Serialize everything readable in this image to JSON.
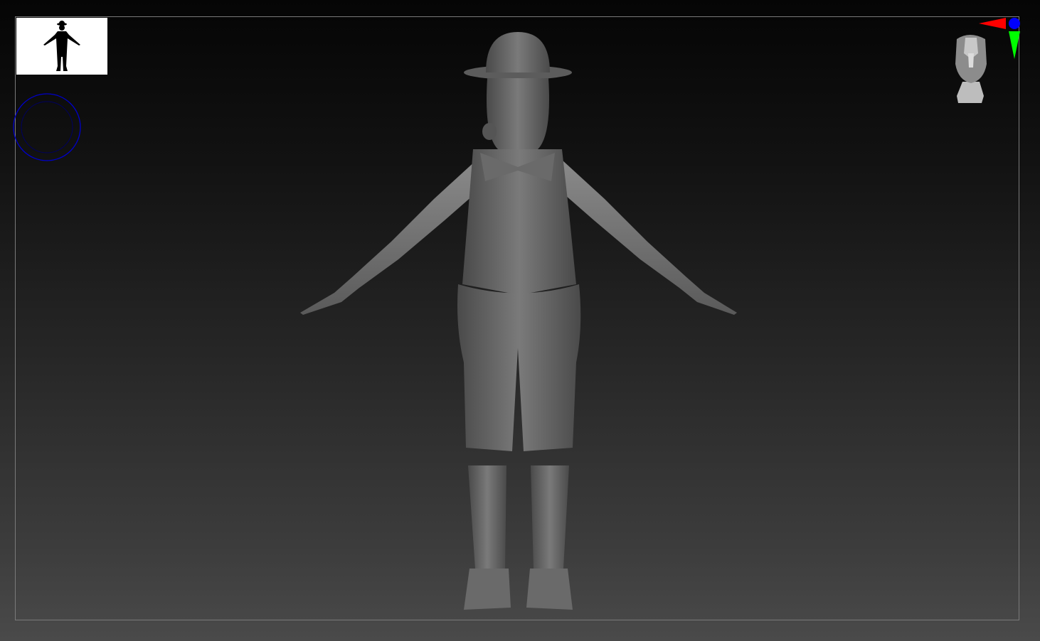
{
  "viewport": {
    "background_top": "#050505",
    "background_bottom": "#4a4a4a",
    "frame_color": "#7a7a7a",
    "model_color": "#6b6b6b"
  },
  "navigator_thumbnail": {
    "icon": "model-silhouette-icon",
    "background": "#ffffff"
  },
  "brush_cursor": {
    "icon": "brush-circle-icon",
    "color": "#0000c8"
  },
  "orientation_gizmo": {
    "icon": "head-orientation-icon",
    "x_axis_color": "#ff0000",
    "y_axis_color": "#00ff00",
    "z_axis_color": "#0000ff"
  }
}
